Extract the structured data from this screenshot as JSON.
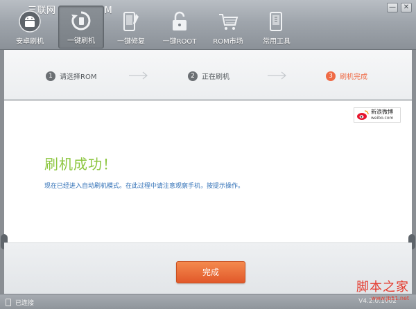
{
  "watermark_top": "三联网 3LIAN.COM",
  "window_controls": {
    "minimize": "—",
    "close": "✕"
  },
  "toolbar": {
    "items": [
      {
        "label": "安卓刷机",
        "icon": "android-icon"
      },
      {
        "label": "一键刷机",
        "icon": "refresh-icon",
        "active": true
      },
      {
        "label": "一键修复",
        "icon": "repair-icon"
      },
      {
        "label": "一键ROOT",
        "icon": "unlock-icon"
      },
      {
        "label": "ROM市场",
        "icon": "cart-icon"
      },
      {
        "label": "常用工具",
        "icon": "tools-icon"
      }
    ]
  },
  "steps": [
    {
      "num": "1",
      "label": "请选择ROM"
    },
    {
      "num": "2",
      "label": "正在刷机"
    },
    {
      "num": "3",
      "label": "刷机完成",
      "current": true
    }
  ],
  "weibo": {
    "cn": "新浪微博",
    "en": "weibo.com"
  },
  "main": {
    "title": "刷机成功！",
    "description": "现在已经进入自动刷机模式。在此过程中请注意观察手机，按提示操作。"
  },
  "done_button": "完成",
  "statusbar": {
    "status": "已连接",
    "version": "V4.2.0.1002"
  },
  "site_watermark": {
    "cn": "脚本之家",
    "url": "www.jb51.net"
  },
  "colors": {
    "accent": "#ef6a45",
    "success": "#8cc63f",
    "link": "#2f6fb6"
  }
}
